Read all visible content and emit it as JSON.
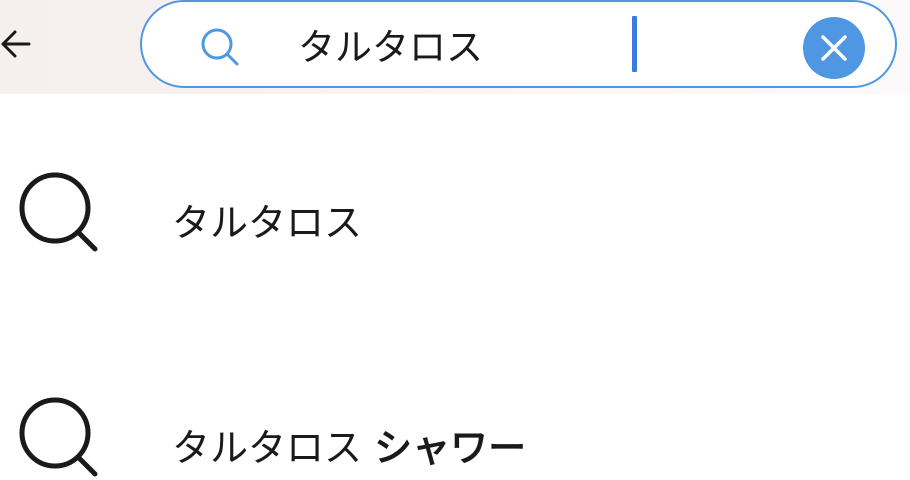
{
  "search": {
    "query": "タルタロス",
    "border_color": "#4f97e3",
    "clear_button_color": "#4f97e3",
    "caret_color": "#3a7be0"
  },
  "header": {
    "back_icon": "arrow-left-icon",
    "search_icon": "search-icon",
    "clear_icon": "close-icon"
  },
  "suggestions": [
    {
      "icon": "search-icon",
      "prefix": "タルタロス",
      "suffix": ""
    },
    {
      "icon": "search-icon",
      "prefix": "タルタロス",
      "suffix": "シャワー"
    }
  ]
}
